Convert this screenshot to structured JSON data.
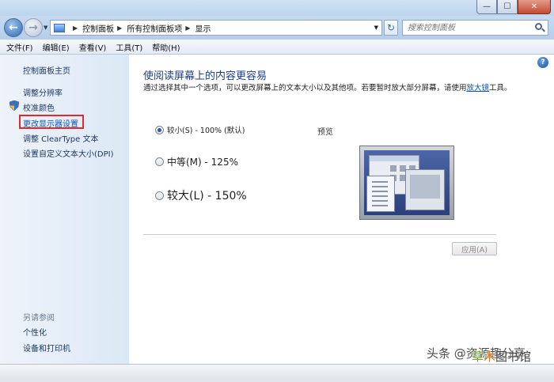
{
  "window": {
    "min_glyph": "—",
    "max_glyph": "☐",
    "close_glyph": "✕"
  },
  "nav": {
    "back_glyph": "←",
    "forward_glyph": "→",
    "breadcrumb": [
      "控制面板",
      "所有控制面板项",
      "显示"
    ],
    "refresh_glyph": "↻",
    "search_placeholder": "搜索控制面板"
  },
  "menu": [
    "文件(F)",
    "编辑(E)",
    "查看(V)",
    "工具(T)",
    "帮助(H)"
  ],
  "sidebar": {
    "home": "控制面板主页",
    "links": [
      "调整分辨率",
      "校准颜色",
      "更改显示器设置",
      "调整 ClearType 文本",
      "设置自定义文本大小(DPI)"
    ],
    "see_also_heading": "另请参阅",
    "see_also": [
      "个性化",
      "设备和打印机"
    ]
  },
  "main": {
    "help_glyph": "?",
    "title": "使阅读屏幕上的内容更容易",
    "desc_before": "通过选择其中一个选项，可以更改屏幕上的文本大小以及其他项。若要暂时放大部分屏幕，请使用",
    "desc_link": "放大镜",
    "desc_after": "工具。",
    "options": [
      {
        "label": "较小(S) - 100% (默认)",
        "selected": true
      },
      {
        "label": "中等(M) - 125%",
        "selected": false
      },
      {
        "label": "较大(L) - 150%",
        "selected": false
      }
    ],
    "preview_label": "预览",
    "apply_label": "应用(A)"
  },
  "watermark": {
    "prefix": "头条 @资源趣分享",
    "logo_a": "草",
    "logo_b": "木",
    "logo_c": "图书馆"
  },
  "colors": {
    "title": "#1d3e85",
    "link": "#0a53c4",
    "highlight_box": "#e12b2b"
  }
}
